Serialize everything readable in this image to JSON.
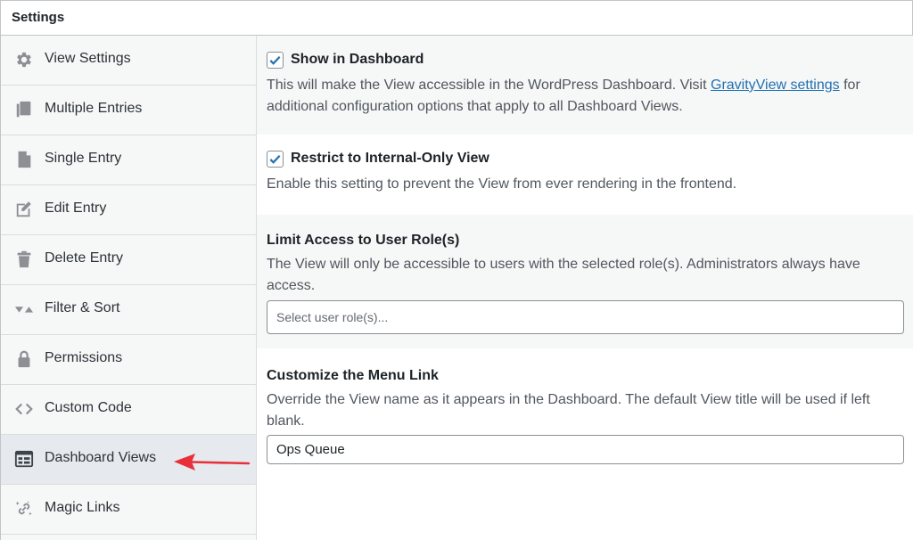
{
  "panel": {
    "title": "Settings"
  },
  "sidebar": {
    "items": [
      {
        "label": "View Settings",
        "icon": "gear-icon"
      },
      {
        "label": "Multiple Entries",
        "icon": "copy-icon"
      },
      {
        "label": "Single Entry",
        "icon": "document-icon"
      },
      {
        "label": "Edit Entry",
        "icon": "edit-icon"
      },
      {
        "label": "Delete Entry",
        "icon": "trash-icon"
      },
      {
        "label": "Filter & Sort",
        "icon": "filter-sort-icon"
      },
      {
        "label": "Permissions",
        "icon": "lock-icon"
      },
      {
        "label": "Custom Code",
        "icon": "code-icon"
      },
      {
        "label": "Dashboard Views",
        "icon": "dashboard-table-icon",
        "active": true
      },
      {
        "label": "Magic Links",
        "icon": "magic-link-icon"
      }
    ]
  },
  "settings": {
    "show_in_dashboard": {
      "label": "Show in Dashboard",
      "checked": true,
      "desc_before": "This will make the View accessible in the WordPress Dashboard. Visit ",
      "link_text": "GravityView settings",
      "desc_after": " for additional configuration options that apply to all Dashboard Views."
    },
    "restrict_internal": {
      "label": "Restrict to Internal-Only View",
      "checked": true,
      "desc": "Enable this setting to prevent the View from ever rendering in the frontend."
    },
    "limit_access": {
      "title": "Limit Access to User Role(s)",
      "desc": "The View will only be accessible to users with the selected role(s). Administrators always have access.",
      "placeholder": "Select user role(s)..."
    },
    "menu_link": {
      "title": "Customize the Menu Link",
      "desc": "Override the View name as it appears in the Dashboard. The default View title will be used if left blank.",
      "value": "Ops Queue"
    }
  },
  "colors": {
    "accent": "#2271b1",
    "annotation_arrow": "#e8303a",
    "active_nav": "#e6eaef"
  }
}
